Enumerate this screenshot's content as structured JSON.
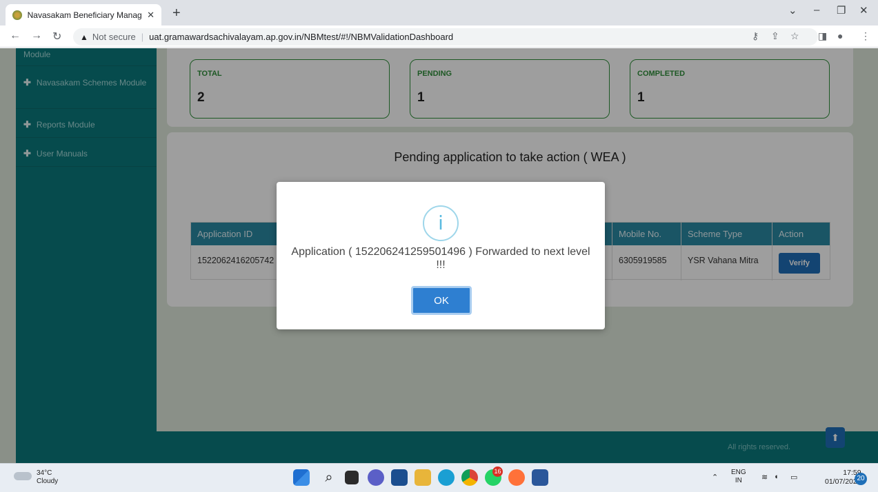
{
  "browser": {
    "tab_title": "Navasakam Beneficiary Manager",
    "tab_close": "✕",
    "new_tab": "+",
    "not_secure": "Not secure",
    "url": "uat.gramawardsachivalayam.ap.gov.in/NBMtest/#!/NBMValidationDashboard"
  },
  "sidebar": {
    "items": [
      {
        "label": "Module"
      },
      {
        "label": "Navasakam Schemes Module"
      },
      {
        "label": "Reports Module"
      },
      {
        "label": "User Manuals"
      }
    ]
  },
  "stats": [
    {
      "label": "TOTAL",
      "value": "2"
    },
    {
      "label": "PENDING",
      "value": "1"
    },
    {
      "label": "COMPLETED",
      "value": "1"
    }
  ],
  "panel": {
    "title": "Pending application to take action ( WEA )"
  },
  "table": {
    "headers": [
      "Application ID",
      "Mobile No.",
      "Scheme Type",
      "Action"
    ],
    "row": {
      "application_id": "1522062416205742",
      "mobile": "6305919585",
      "scheme_type": "YSR Vahana Mitra",
      "action_label": "Verify"
    }
  },
  "footer": {
    "text": "All rights reserved."
  },
  "modal": {
    "icon": "info-icon",
    "message": "Application ( 152206241259501496 ) Forwarded to next level !!!",
    "ok_label": "OK"
  },
  "taskbar": {
    "weather_temp": "34°C",
    "weather_desc": "Cloudy",
    "lang_top": "ENG",
    "lang_bottom": "IN",
    "time": "17:59",
    "date": "01/07/2022",
    "notifications": "20",
    "whatsapp_badge": "16"
  },
  "colors": {
    "sidebar": "#0a7a7d",
    "accent_green": "#2f8f3a",
    "table_header": "#2a8aa3",
    "button_blue": "#1f6fb8"
  }
}
